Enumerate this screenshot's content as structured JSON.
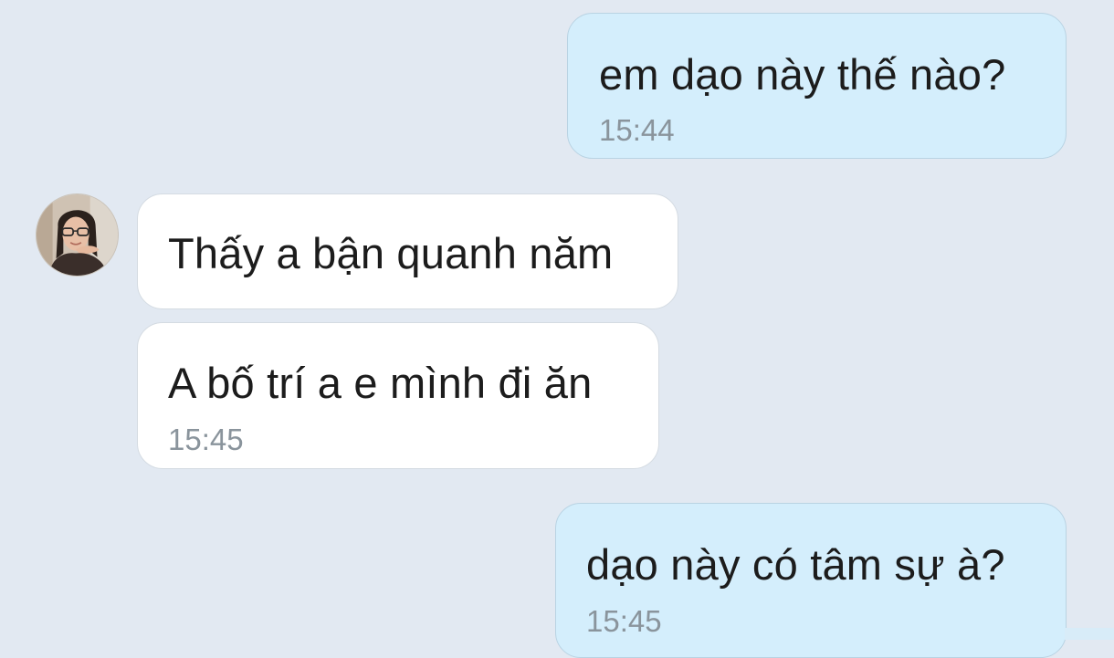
{
  "conversation": {
    "messages": [
      {
        "direction": "outgoing",
        "text": "em dạo này thế nào?",
        "time": "15:44"
      },
      {
        "direction": "incoming",
        "text": "Thấy a bận quanh năm",
        "time": ""
      },
      {
        "direction": "incoming",
        "text": "A bố trí a e mình đi ăn",
        "time": "15:45"
      },
      {
        "direction": "outgoing",
        "text": "dạo này có tâm sự à?",
        "time": "15:45"
      }
    ],
    "contact_avatar_icon": "profile-photo"
  },
  "colors": {
    "background": "#e2e9f2",
    "outgoing_bubble": "#d4eefc",
    "incoming_bubble": "#ffffff",
    "timestamp": "#8a949c"
  }
}
